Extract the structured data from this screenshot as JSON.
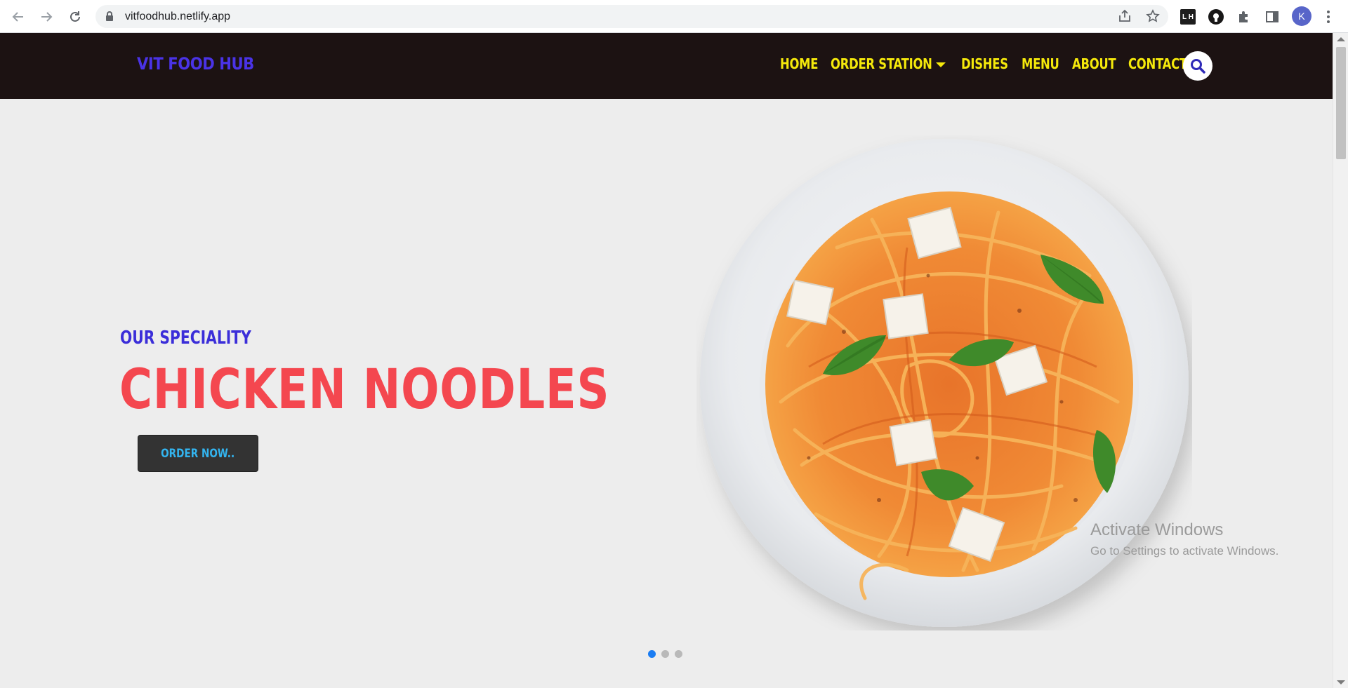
{
  "browser": {
    "url": "vitfoodhub.netlify.app",
    "profile_initial": "K",
    "extensions": {
      "lh_label": "L H",
      "icons": [
        "share-icon",
        "star-icon",
        "lighthouse-extension-icon",
        "github-extension-icon",
        "puzzle-icon",
        "side-panel-icon"
      ]
    }
  },
  "site": {
    "brand": "VIT FOOD HUB",
    "nav": {
      "home": "HOME",
      "order_station": "ORDER STATION",
      "dishes": "DISHES",
      "menu": "MENU",
      "about": "ABOUT",
      "contact": "CONTACT"
    },
    "colors": {
      "navbar_bg": "#1c1212",
      "brand": "#4a33e6",
      "nav_link": "#f5e90b",
      "title_red": "#f4474f",
      "speciality_blue": "#3b2ed9",
      "button_text": "#33b4ef"
    }
  },
  "hero": {
    "kicker": "OUR SPECIALITY",
    "title": "CHICKEN NOODLES",
    "cta": "ORDER NOW..",
    "carousel": {
      "slides": 3,
      "active": 1
    }
  },
  "watermark": {
    "title": "Activate Windows",
    "subtitle": "Go to Settings to activate Windows."
  }
}
